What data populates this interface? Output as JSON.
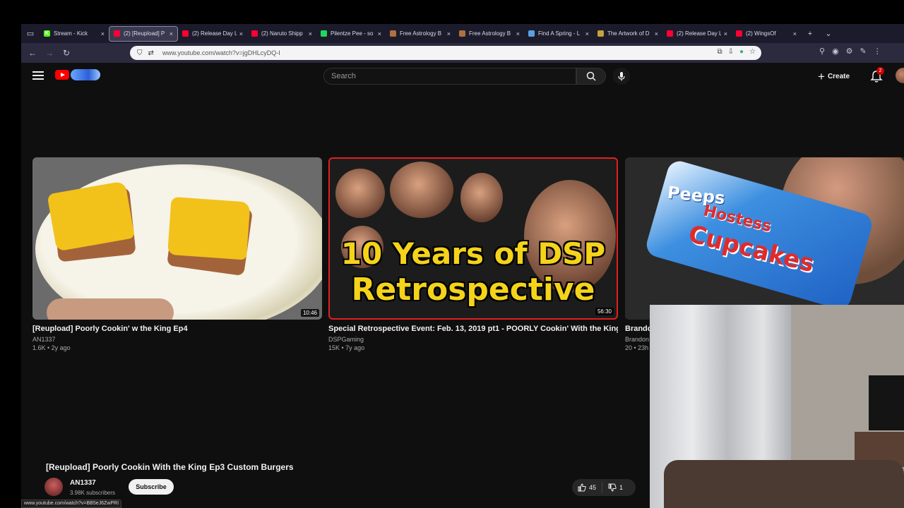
{
  "browser": {
    "tabs": [
      {
        "title": "Stream - Kick",
        "icon": "kick-icon",
        "color": "#53fc18",
        "glyph": "K",
        "active": false
      },
      {
        "title": "(2) [Reupload] P",
        "icon": "youtube-icon",
        "color": "#ff0033",
        "glyph": "",
        "active": true
      },
      {
        "title": "(2) Release Day L",
        "icon": "youtube-icon",
        "color": "#ff0033",
        "glyph": "",
        "active": false
      },
      {
        "title": "(2) Naruto Shipp",
        "icon": "youtube-icon",
        "color": "#ff0033",
        "glyph": "",
        "active": false
      },
      {
        "title": "Pilentze Pee - so",
        "icon": "spotify-icon",
        "color": "#1ed760",
        "glyph": "",
        "active": false
      },
      {
        "title": "Free Astrology B",
        "icon": "astrology-icon",
        "color": "#b07040",
        "glyph": "",
        "active": false
      },
      {
        "title": "Free Astrology B",
        "icon": "astrology-icon",
        "color": "#b07040",
        "glyph": "",
        "active": false
      },
      {
        "title": "Find A Spring - L",
        "icon": "spring-icon",
        "color": "#5aa0e0",
        "glyph": "",
        "active": false
      },
      {
        "title": "The Artwork of D",
        "icon": "artwork-icon",
        "color": "#c8a040",
        "glyph": "",
        "active": false
      },
      {
        "title": "(2) Release Day L",
        "icon": "youtube-icon",
        "color": "#ff0033",
        "glyph": "",
        "active": false
      },
      {
        "title": "(2) WingsOf",
        "icon": "youtube-icon",
        "color": "#ff0033",
        "glyph": "",
        "active": false
      }
    ],
    "url": "www.youtube.com/watch?v=jgDHLcyDQ-I",
    "status_url": "www.youtube.com/watch?v=BB5eJ6ZwPRI"
  },
  "masthead": {
    "search_placeholder": "Search",
    "create_label": "Create",
    "notification_count": "2"
  },
  "related": [
    {
      "title": "[Reupload] Poorly Cookin' w the King Ep4",
      "channel": "AN1337",
      "meta": "1.6K • 2y ago",
      "duration": "10:46"
    },
    {
      "title": "Special Retrospective Event: Feb. 13, 2019 pt1 - POORLY Cookin' With the King",
      "channel": "DSPGaming",
      "meta": "15K • 7y ago",
      "duration": "56:30",
      "thumb_text": [
        "10 Years of DSP",
        "Retrospective"
      ]
    },
    {
      "title": "Brando",
      "channel": "Brandon",
      "meta": "20 • 23h",
      "duration": "",
      "thumb_text": [
        "Peeps",
        "Hostess",
        "Cupcakes"
      ]
    }
  ],
  "watch": {
    "title": "[Reupload] Poorly Cookin With the King Ep3 Custom Burgers",
    "channel": "AN1337",
    "subscribers": "3.98K subscribers",
    "subscribe_label": "Subscribe",
    "likes": "45",
    "dislikes": "1"
  },
  "colors": {
    "background": "#0f0f0f",
    "brand_red": "#ff0000",
    "thumb_yellow": "#f4d31a"
  }
}
